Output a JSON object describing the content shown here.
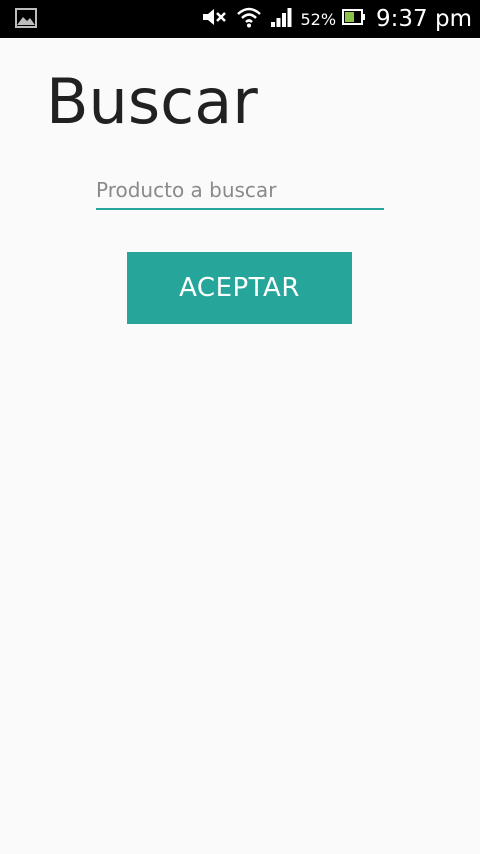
{
  "status_bar": {
    "icons": [
      "gallery-icon",
      "mute-icon",
      "wifi-icon",
      "signal-icon",
      "battery-icon"
    ],
    "battery_percent": "52%",
    "time": "9:37 pm"
  },
  "screen": {
    "title": "Buscar",
    "search_placeholder": "Producto a buscar",
    "search_value": "",
    "accept_label": "ACEPTAR"
  },
  "colors": {
    "accent": "#26a69a",
    "background": "#fafafa",
    "status_bar": "#000000"
  }
}
